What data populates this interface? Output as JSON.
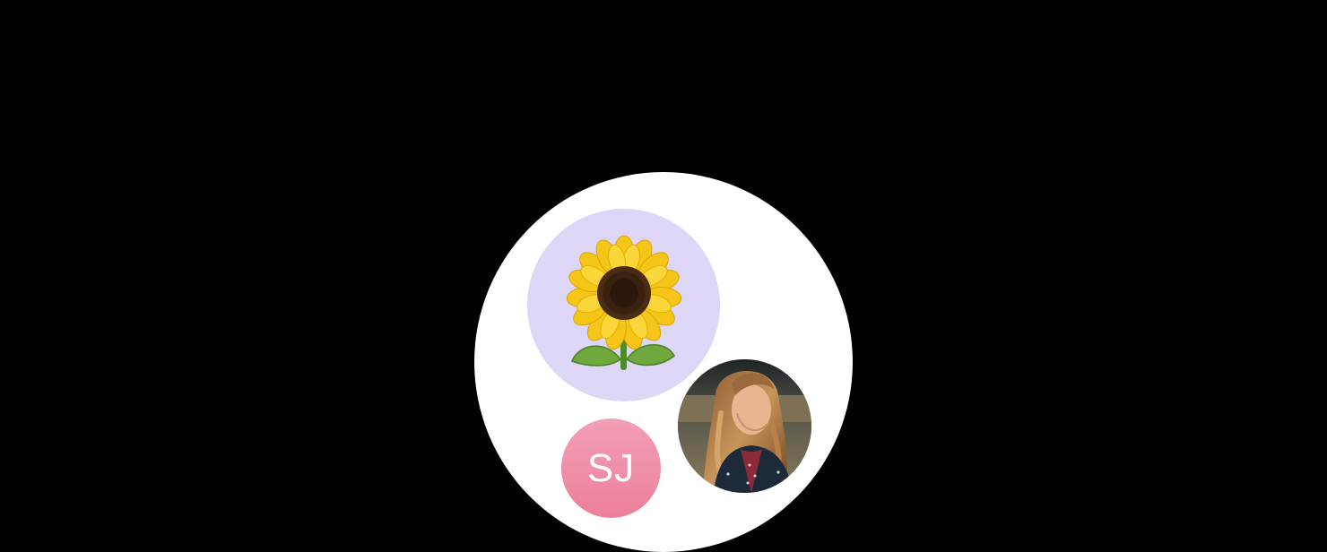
{
  "avatar_group": {
    "avatars": [
      {
        "kind": "emoji",
        "icon": "sunflower-icon",
        "background": "#ddd6f7"
      },
      {
        "kind": "initials",
        "initials": "SJ",
        "background": "#ee8aa5",
        "text_color": "#ffffff"
      },
      {
        "kind": "photo",
        "icon": "person-photo"
      }
    ]
  }
}
